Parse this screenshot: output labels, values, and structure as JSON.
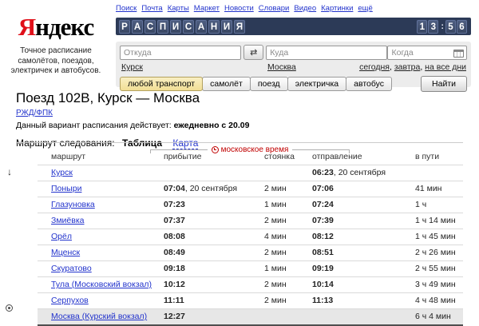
{
  "topnav": {
    "links": [
      "Поиск",
      "Почта",
      "Карты",
      "Маркет",
      "Новости",
      "Словари",
      "Видео",
      "Картинки",
      "ещё"
    ]
  },
  "logo": {
    "first_letter": "Я",
    "rest": "ндекс",
    "tagline": "Точное расписание самолётов, поездов, электричек и автобусов."
  },
  "banner": {
    "title_letters": [
      "Р",
      "А",
      "С",
      "П",
      "И",
      "С",
      "А",
      "Н",
      "И",
      "Я"
    ],
    "clock": "13:56"
  },
  "search": {
    "from": {
      "placeholder": "Откуда",
      "suggestion": "Курск"
    },
    "to": {
      "placeholder": "Куда",
      "suggestion": "Москва"
    },
    "when": {
      "placeholder": "Когда",
      "quick_links": [
        "сегодня",
        "завтра",
        "на все дни"
      ]
    },
    "swap_icon": "⇄",
    "transport_tabs": [
      {
        "label": "любой транспорт",
        "selected": true
      },
      {
        "label": "самолёт",
        "selected": false
      },
      {
        "label": "поезд",
        "selected": false
      },
      {
        "label": "электричка",
        "selected": false
      },
      {
        "label": "автобус",
        "selected": false
      }
    ],
    "submit_label": "Найти"
  },
  "page": {
    "title": "Поезд 102В, Курск — Москва",
    "carrier": "РЖД/ФПК",
    "validity_label": "Данный вариант расписания действует:",
    "validity_value": "ежедневно с 20.09",
    "route_label": "Маршрут следования:",
    "view_table_label": "Таблица",
    "view_map_label": "Карта"
  },
  "table": {
    "timezone_note": "московское время",
    "columns": [
      "маршрут",
      "прибытие",
      "стоянка",
      "отправление",
      "в пути"
    ],
    "rows": [
      {
        "station": "Курск",
        "arrival": "",
        "arrival_suffix": "",
        "stop": "",
        "departure": "06:23",
        "departure_suffix": ", 20 сентября",
        "travel": "",
        "highlight": false
      },
      {
        "station": "Поныри",
        "arrival": "07:04",
        "arrival_suffix": ", 20 сентября",
        "stop": "2 мин",
        "departure": "07:06",
        "departure_suffix": "",
        "travel": "41 мин",
        "highlight": false
      },
      {
        "station": "Глазуновка",
        "arrival": "07:23",
        "arrival_suffix": "",
        "stop": "1 мин",
        "departure": "07:24",
        "departure_suffix": "",
        "travel": "1 ч",
        "highlight": false
      },
      {
        "station": "Змиёвка",
        "arrival": "07:37",
        "arrival_suffix": "",
        "stop": "2 мин",
        "departure": "07:39",
        "departure_suffix": "",
        "travel": "1 ч 14 мин",
        "highlight": false
      },
      {
        "station": "Орёл",
        "arrival": "08:08",
        "arrival_suffix": "",
        "stop": "4 мин",
        "departure": "08:12",
        "departure_suffix": "",
        "travel": "1 ч 45 мин",
        "highlight": false
      },
      {
        "station": "Мценск",
        "arrival": "08:49",
        "arrival_suffix": "",
        "stop": "2 мин",
        "departure": "08:51",
        "departure_suffix": "",
        "travel": "2 ч 26 мин",
        "highlight": false
      },
      {
        "station": "Скуратово",
        "arrival": "09:18",
        "arrival_suffix": "",
        "stop": "1 мин",
        "departure": "09:19",
        "departure_suffix": "",
        "travel": "2 ч 55 мин",
        "highlight": false
      },
      {
        "station": "Тула (Московский вокзал)",
        "arrival": "10:12",
        "arrival_suffix": "",
        "stop": "2 мин",
        "departure": "10:14",
        "departure_suffix": "",
        "travel": "3 ч 49 мин",
        "highlight": false
      },
      {
        "station": "Серпухов",
        "arrival": "11:11",
        "arrival_suffix": "",
        "stop": "2 мин",
        "departure": "11:13",
        "departure_suffix": "",
        "travel": "4 ч 48 мин",
        "highlight": false
      },
      {
        "station": "Москва (Курский вокзал)",
        "arrival": "12:27",
        "arrival_suffix": "",
        "stop": "",
        "departure": "",
        "departure_suffix": "",
        "travel": "6 ч 4 мин",
        "highlight": true
      }
    ]
  },
  "colors": {
    "banner_navy": "#2c3a57",
    "link_blue": "#2233cc",
    "logo_red": "#e0101a",
    "note_red": "#c00000",
    "selected_tab_yellow": "#f1de95",
    "highlight_row_gray": "#e7e7e7"
  }
}
